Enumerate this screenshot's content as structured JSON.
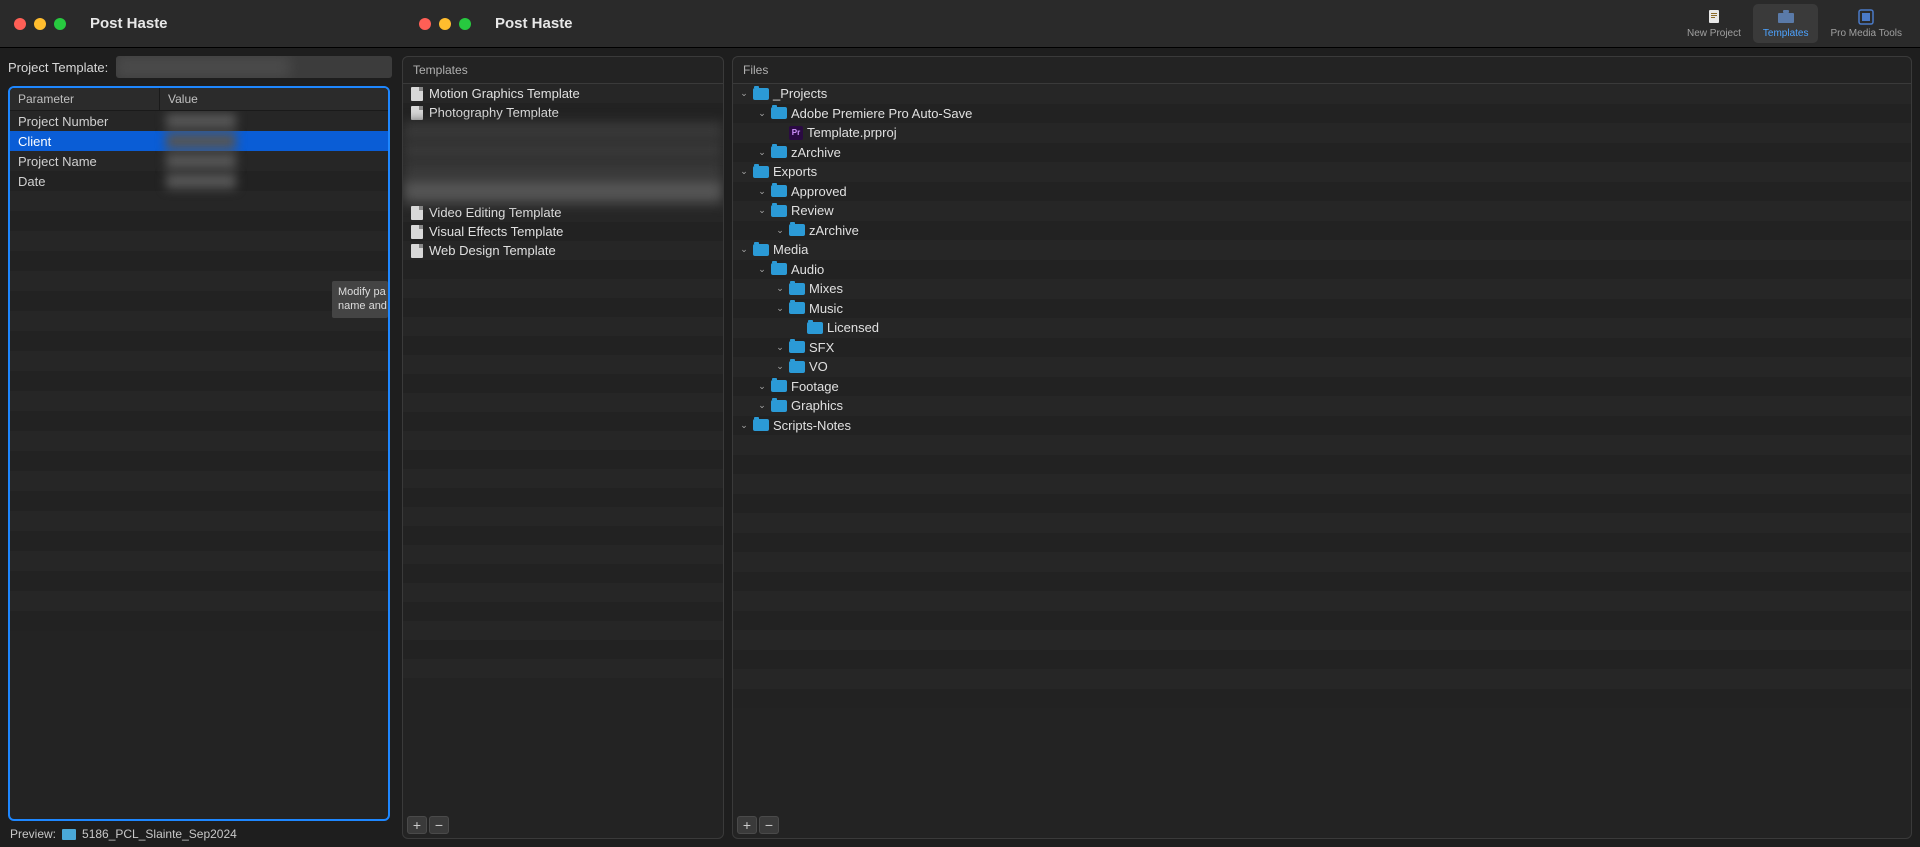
{
  "window": {
    "title": "Post Haste",
    "title2": "Post Haste"
  },
  "toolbar": {
    "new_project": "New Project",
    "templates": "Templates",
    "pro_media_tools": "Pro Media Tools"
  },
  "left": {
    "project_template_label": "Project Template:",
    "header_parameter": "Parameter",
    "header_value": "Value",
    "rows": [
      {
        "label": "Project Number",
        "value": ""
      },
      {
        "label": "Client",
        "value": ""
      },
      {
        "label": "Project Name",
        "value": ""
      },
      {
        "label": "Date",
        "value": ""
      }
    ],
    "tooltip": "Modify pa\nname and",
    "preview_label": "Preview:",
    "preview_value": "5186_PCL_Slainte_Sep2024"
  },
  "templates": {
    "header": "Templates",
    "items": [
      {
        "name": "Motion Graphics Template",
        "kind": "doc"
      },
      {
        "name": "Photography Template",
        "kind": "doc"
      },
      {
        "name": "",
        "kind": "blur"
      },
      {
        "name": "",
        "kind": "blur"
      },
      {
        "name": "",
        "kind": "blur"
      },
      {
        "name": "",
        "kind": "blur-sel"
      },
      {
        "name": "Video Editing Template",
        "kind": "doc"
      },
      {
        "name": "Visual Effects Template",
        "kind": "doc"
      },
      {
        "name": "Web Design Template",
        "kind": "doc"
      }
    ],
    "add": "+",
    "remove": "−"
  },
  "files": {
    "header": "Files",
    "tree": [
      {
        "indent": 0,
        "open": true,
        "type": "folder",
        "name": "_Projects"
      },
      {
        "indent": 1,
        "open": true,
        "type": "folder",
        "name": "Adobe Premiere Pro Auto-Save"
      },
      {
        "indent": 2,
        "open": null,
        "type": "prproj",
        "name": "Template.prproj"
      },
      {
        "indent": 1,
        "open": true,
        "type": "folder",
        "name": "zArchive"
      },
      {
        "indent": 0,
        "open": true,
        "type": "folder",
        "name": "Exports"
      },
      {
        "indent": 1,
        "open": true,
        "type": "folder",
        "name": "Approved"
      },
      {
        "indent": 1,
        "open": true,
        "type": "folder",
        "name": "Review"
      },
      {
        "indent": 2,
        "open": true,
        "type": "folder",
        "name": "zArchive"
      },
      {
        "indent": 0,
        "open": true,
        "type": "folder",
        "name": "Media"
      },
      {
        "indent": 1,
        "open": true,
        "type": "folder",
        "name": "Audio"
      },
      {
        "indent": 2,
        "open": true,
        "type": "folder",
        "name": "Mixes"
      },
      {
        "indent": 2,
        "open": true,
        "type": "folder",
        "name": "Music"
      },
      {
        "indent": 3,
        "open": null,
        "type": "folder",
        "name": "Licensed"
      },
      {
        "indent": 2,
        "open": true,
        "type": "folder",
        "name": "SFX"
      },
      {
        "indent": 2,
        "open": true,
        "type": "folder",
        "name": "VO"
      },
      {
        "indent": 1,
        "open": true,
        "type": "folder",
        "name": "Footage"
      },
      {
        "indent": 1,
        "open": true,
        "type": "folder",
        "name": "Graphics"
      },
      {
        "indent": 0,
        "open": true,
        "type": "folder",
        "name": "Scripts-Notes"
      }
    ],
    "add": "+",
    "remove": "−"
  }
}
